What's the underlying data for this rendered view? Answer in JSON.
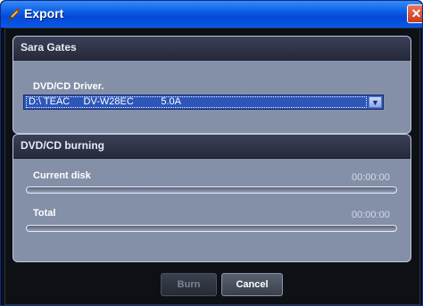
{
  "window": {
    "title": "Export",
    "close_glyph": "✕"
  },
  "user_panel": {
    "title": "Sara Gates",
    "driver_label": "DVD/CD Driver.",
    "driver_value": "D:\\ TEAC     DV-W28EC          5.0A"
  },
  "burning_panel": {
    "title": "DVD/CD burning",
    "current_label": "Current disk",
    "current_time": "00:00:00",
    "current_progress": 0,
    "total_label": "Total",
    "total_time": "00:00:00",
    "total_progress": 0
  },
  "buttons": {
    "burn": "Burn",
    "cancel": "Cancel"
  },
  "icons": {
    "title": "pen-icon",
    "close": "close-icon",
    "dropdown": "chevron-down-icon"
  },
  "colors": {
    "titlebar": "#0a5ee8",
    "panel": "#8490a8",
    "panel_header": "#262a3a",
    "selection": "#2c56b8"
  }
}
